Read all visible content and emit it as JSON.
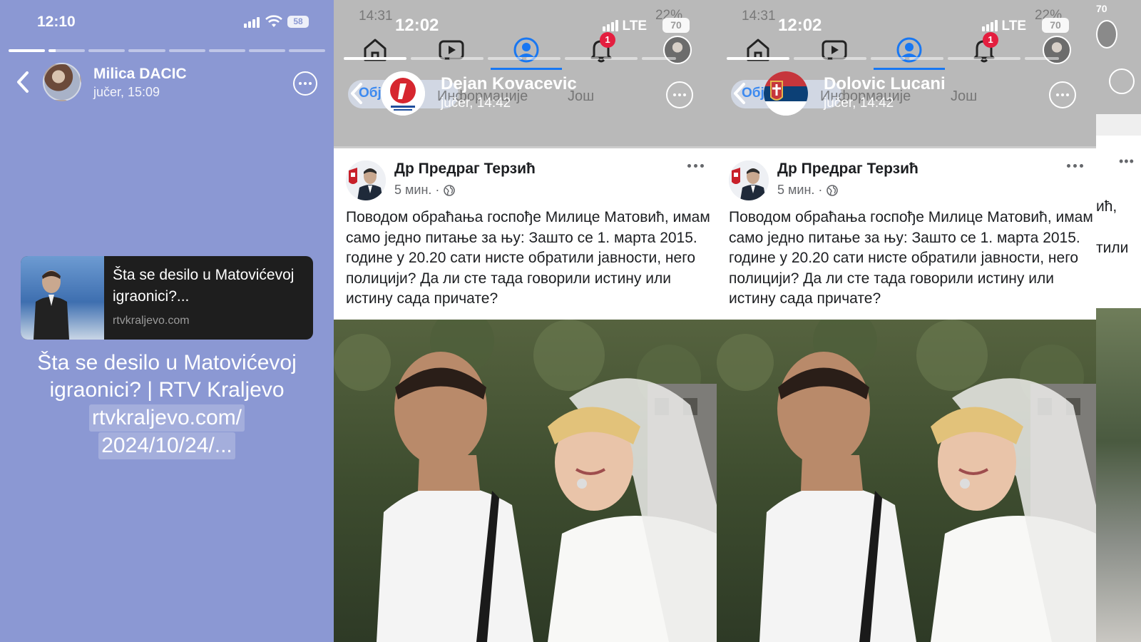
{
  "story": {
    "status_time": "12:10",
    "battery": "58",
    "user_name": "Milica DACIC",
    "posted_time": "jučer, 15:09",
    "link_card": {
      "title": "Šta se desilo u Matovićevoj igraonici?...",
      "domain": "rtvkraljevo.com"
    },
    "big_title": "Šta se desilo u Matovićevoj igraonici? | RTV Kraljevo",
    "url_lines": [
      "rtvkraljevo.com/",
      "2024/10/24/..."
    ]
  },
  "fb_left": {
    "ghost_time": "14:31",
    "ghost_signal": "22%",
    "status_time": "12:02",
    "network": "LTE",
    "battery": "70",
    "notif_badge": "1",
    "ghost_tab": "Обја",
    "ghost_info": "Информације",
    "ghost_more": "Још",
    "page_name": "Dejan Kovacevic",
    "page_time": "jučer, 14:42",
    "post_author": "Др Предраг Терзић",
    "post_meta": "5 мин. ·",
    "post_text": "Поводом обраћања госпође Милице Матовић, имам само једно питање за њу: Зашто се 1. марта 2015. године у 20.20 сати нисте обратили јавности, него полицији? Да ли сте тада говорили истину или истину сада причате?"
  },
  "fb_right": {
    "ghost_time": "14:31",
    "ghost_signal": "22%",
    "status_time": "12:02",
    "network": "LTE",
    "battery": "70",
    "notif_badge": "1",
    "ghost_tab": "Обја",
    "ghost_info": "Информације",
    "ghost_more": "Још",
    "page_name": "Dolovic Lucani",
    "page_time": "jučer, 14:42",
    "post_author": "Др Предраг Терзић",
    "post_meta": "5 мин. ·",
    "post_text": "Поводом обраћања госпође Милице Матовић, имам само једно питање за њу: Зашто се 1. марта 2015. године у 20.20 сати нисте обратили јавности, него полицији? Да ли сте тада говорили истину или истину сада причате?"
  },
  "edge_panel": {
    "battery": "70",
    "fragment_1": "ић,",
    "fragment_2": "тили"
  },
  "colors": {
    "story_bg": "#8b98d3",
    "fb_blue": "#1877f2",
    "badge_red": "#e41e3f",
    "header_gray": "#b9b9b9"
  }
}
